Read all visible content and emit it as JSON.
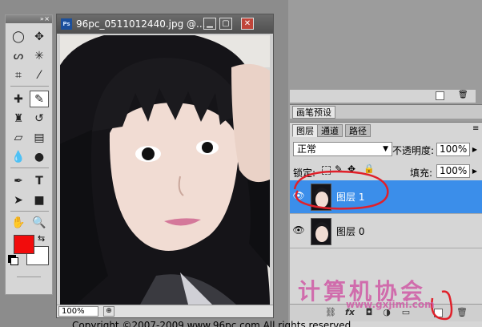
{
  "document": {
    "title": "96pc_0511012440.jpg @...",
    "ps_badge": "Ps",
    "zoom": "100%"
  },
  "tools_panel": {
    "collapse_glyph": "» ×"
  },
  "colors": {
    "foreground": "#f20c0c",
    "background": "#ffffff",
    "selected_layer": "#3b8eea",
    "annotation_red": "#e0202a"
  },
  "panels": {
    "brush_presets_tab": "画笔预设",
    "layers_tabs": [
      "图层",
      "通道",
      "路径"
    ],
    "blend_mode": "正常",
    "opacity_label": "不透明度:",
    "opacity_value": "100%",
    "lock_label": "锁定:",
    "fill_label": "填充:",
    "fill_value": "100%",
    "layers": [
      {
        "name": "图层 1",
        "selected": true
      },
      {
        "name": "图层 0",
        "selected": false
      }
    ]
  },
  "watermark": {
    "title": "计算机协会",
    "url": "www.gxjimi.com"
  },
  "footer": {
    "copyright": "Copyright ©2007-2009 www.96pc.com All rights reserved"
  }
}
